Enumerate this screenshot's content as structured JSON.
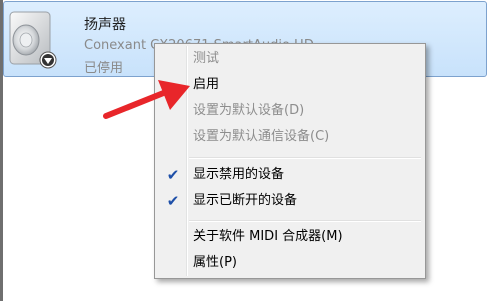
{
  "device": {
    "name": "扬声器",
    "description": "Conexant CX20671 SmartAudio HD",
    "status": "已停用"
  },
  "icons": {
    "speaker": "speaker-icon",
    "disabled_badge": "disabled-badge-icon",
    "annotation": "red-arrow-icon",
    "check": "check-icon"
  },
  "colors": {
    "selection_bg": "#c8e2fb",
    "selection_border": "#7da2ce",
    "menu_bg": "#f0f0f0",
    "disabled_text": "#8d8d8d",
    "check_color": "#1e4fa8",
    "arrow_red": "#e8262a"
  },
  "context_menu": {
    "items": [
      {
        "label": "测试",
        "enabled": false,
        "checked": false
      },
      {
        "label": "启用",
        "enabled": true,
        "checked": false
      },
      {
        "label": "设置为默认设备(D)",
        "enabled": false,
        "checked": false
      },
      {
        "label": "设置为默认通信设备(C)",
        "enabled": false,
        "checked": false
      },
      {
        "label": "显示禁用的设备",
        "enabled": true,
        "checked": true
      },
      {
        "label": "显示已断开的设备",
        "enabled": true,
        "checked": true
      },
      {
        "label": "关于软件 MIDI 合成器(M)",
        "enabled": true,
        "checked": false
      },
      {
        "label": "属性(P)",
        "enabled": true,
        "checked": false
      }
    ]
  }
}
